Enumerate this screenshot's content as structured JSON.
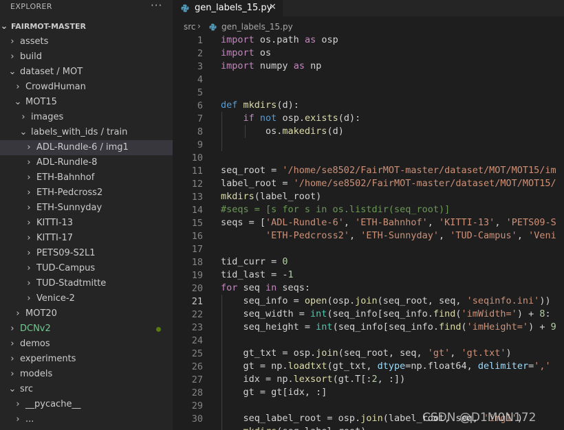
{
  "explorer": {
    "title": "EXPLORER",
    "more": "···",
    "root": "FAIRMOT-MASTER",
    "items": [
      {
        "label": "assets"
      },
      {
        "label": "build"
      },
      {
        "label": "dataset / MOT"
      },
      {
        "label": "CrowdHuman"
      },
      {
        "label": "MOT15"
      },
      {
        "label": "images"
      },
      {
        "label": "labels_with_ids / train"
      },
      {
        "label": "ADL-Rundle-6 / img1"
      },
      {
        "label": "ADL-Rundle-8"
      },
      {
        "label": "ETH-Bahnhof"
      },
      {
        "label": "ETH-Pedcross2"
      },
      {
        "label": "ETH-Sunnyday"
      },
      {
        "label": "KITTI-13"
      },
      {
        "label": "KITTI-17"
      },
      {
        "label": "PETS09-S2L1"
      },
      {
        "label": "TUD-Campus"
      },
      {
        "label": "TUD-Stadtmitte"
      },
      {
        "label": "Venice-2"
      },
      {
        "label": "MOT20"
      },
      {
        "label": "DCNv2"
      },
      {
        "label": "demos"
      },
      {
        "label": "experiments"
      },
      {
        "label": "models"
      },
      {
        "label": "src"
      },
      {
        "label": "__pycache__"
      },
      {
        "label": "..."
      }
    ]
  },
  "tab": {
    "label": "gen_labels_15.py",
    "close": "✕"
  },
  "breadcrumb": {
    "folder": "src",
    "sep": "›",
    "file": "gen_labels_15.py"
  },
  "code": {
    "lines": [
      "1",
      "2",
      "3",
      "4",
      "5",
      "6",
      "7",
      "8",
      "9",
      "10",
      "11",
      "12",
      "13",
      "14",
      "15",
      "16",
      "17",
      "18",
      "19",
      "20",
      "21",
      "22",
      "23",
      "24",
      "25",
      "26",
      "27",
      "28",
      "29",
      "30"
    ]
  },
  "watermark": "CSDN @D1M0N172",
  "colors": {
    "accent": "#007acc",
    "python_icon": "#519aba"
  }
}
